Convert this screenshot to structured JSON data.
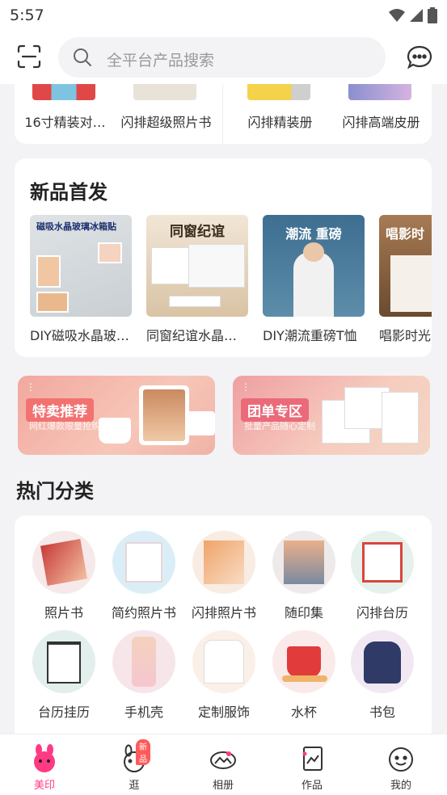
{
  "status": {
    "time": "5:57"
  },
  "search": {
    "placeholder": "全平台产品搜索"
  },
  "top_row": {
    "items": [
      {
        "label": "16寸精装对…"
      },
      {
        "label": "闪排超级照片书"
      },
      {
        "label": "闪排精装册"
      },
      {
        "label": "闪排高端皮册"
      }
    ]
  },
  "new_products": {
    "title": "新品首发",
    "items": [
      {
        "label": "DIY磁吸水晶玻…",
        "caption": "磁吸水晶玻璃冰箱贴"
      },
      {
        "label": "同窗纪谊水晶…",
        "caption": "同窗纪谊"
      },
      {
        "label": "DIY潮流重磅T恤",
        "caption": "潮流 重磅"
      },
      {
        "label": "唱影时光",
        "caption": "唱影时"
      }
    ]
  },
  "banners": [
    {
      "tag": "特卖推荐",
      "sub": "网红爆款限量抢购",
      "color": "#f07878"
    },
    {
      "tag": "团单专区",
      "sub": "批量产品随心定制",
      "color": "#e86a78"
    }
  ],
  "hot": {
    "title": "热门分类",
    "items": [
      {
        "label": "照片书"
      },
      {
        "label": "简约照片书"
      },
      {
        "label": "闪排照片书"
      },
      {
        "label": "随印集"
      },
      {
        "label": "闪排台历"
      },
      {
        "label": "台历挂历"
      },
      {
        "label": "手机壳"
      },
      {
        "label": "定制服饰"
      },
      {
        "label": "水杯"
      },
      {
        "label": "书包"
      }
    ]
  },
  "nav": {
    "items": [
      {
        "label": "美印"
      },
      {
        "label": "逛"
      },
      {
        "label": "相册"
      },
      {
        "label": "作品"
      },
      {
        "label": "我的"
      }
    ],
    "badge": "新品",
    "active_color": "#ff3a84"
  }
}
